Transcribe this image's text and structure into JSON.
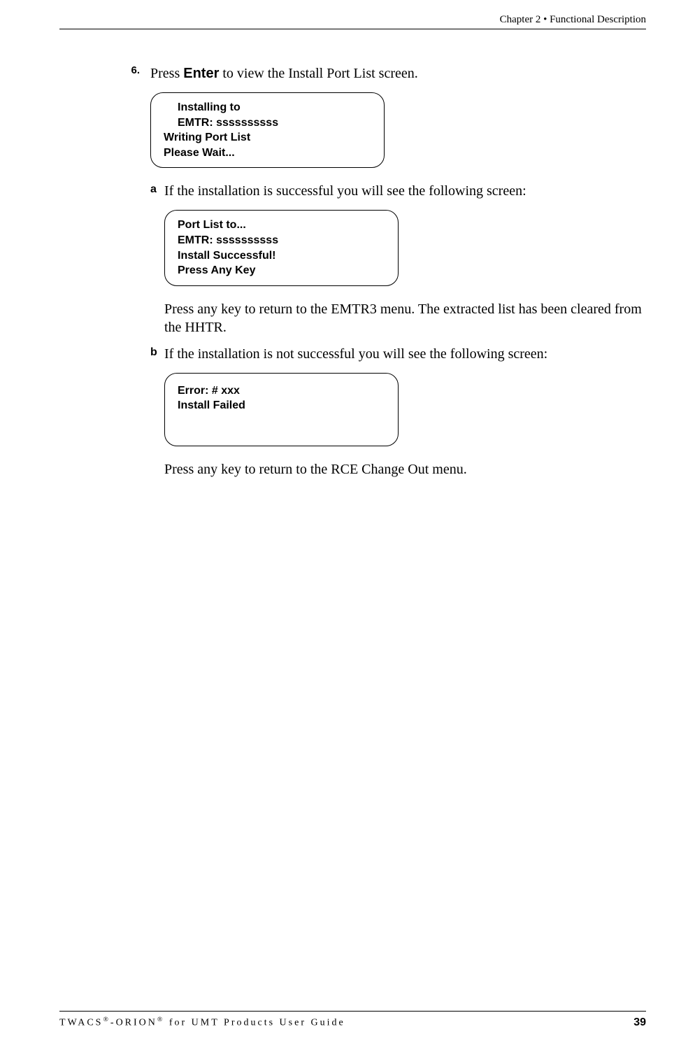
{
  "header": {
    "chapter": "Chapter 2 • Functional Description"
  },
  "content": {
    "step6_number": "6.",
    "step6_text_pre": "Press ",
    "step6_text_bold": "Enter",
    "step6_text_post": " to view the Install Port List screen.",
    "screen1": {
      "line1": "Installing to",
      "line2": "EMTR:  ssssssssss",
      "line3": "Writing Port List",
      "line4": "Please Wait..."
    },
    "sub_a_letter": "a",
    "sub_a_text": "If the installation is successful you will see the following screen:",
    "screen2": {
      "line1": "Port List to...",
      "line2": "EMTR:  ssssssssss",
      "line3": "Install Successful!",
      "line4": "Press Any Key"
    },
    "para_after_a": "Press any key to return to the EMTR3 menu. The extracted list has been cleared from the HHTR.",
    "sub_b_letter": "b",
    "sub_b_text": "If the installation is not successful you will see the following screen:",
    "screen3": {
      "line1": "Error: # xxx",
      "line2": "",
      "line3": "Install Failed"
    },
    "para_after_b": "Press any key to return to the RCE Change Out menu."
  },
  "footer": {
    "left_part1": "TWACS",
    "left_reg1": "®",
    "left_part2": "-ORION",
    "left_reg2": "®",
    "left_part3": " for UMT Products User Guide",
    "page_number": "39"
  }
}
